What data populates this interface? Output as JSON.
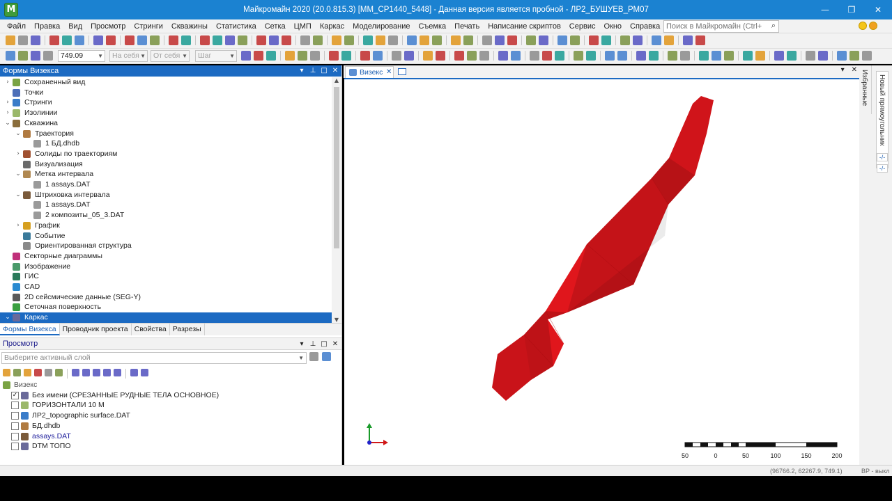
{
  "window": {
    "logo_letter": "M",
    "title": "Майкромайн 2020 (20.0.815.3) [MM_CP1440_5448] - Данная версия является пробной - ЛР2_БУШУЕВ_РМ07",
    "minimize": "—",
    "maximize": "❐",
    "close": "✕"
  },
  "menu": {
    "items": [
      "Файл",
      "Правка",
      "Вид",
      "Просмотр",
      "Стринги",
      "Скважины",
      "Статистика",
      "Сетка",
      "ЦМП",
      "Каркас",
      "Моделирование",
      "Съемка",
      "Печать",
      "Написание скриптов",
      "Сервис",
      "Окно",
      "Справка"
    ],
    "search_placeholder": "Поиск в Майкромайн (Ctrl+Q)"
  },
  "toolbar2": {
    "value": "749.09",
    "from_self": "На себя",
    "to_self": "От себя",
    "step": "Шаг"
  },
  "forms_panel": {
    "title": "Формы Визекса",
    "tree": [
      {
        "label": "Сохраненный вид",
        "level": 0,
        "expander": "›",
        "icon_color": "#7aa343"
      },
      {
        "label": "Точки",
        "level": 0,
        "expander": "",
        "icon_color": "#4d6fb8"
      },
      {
        "label": "Стринги",
        "level": 0,
        "expander": "›",
        "icon_color": "#3a7cc9"
      },
      {
        "label": "Изолинии",
        "level": 0,
        "expander": "›",
        "icon_color": "#9bb86a"
      },
      {
        "label": "Скважина",
        "level": 0,
        "expander": "⌄",
        "icon_color": "#8a6d3b"
      },
      {
        "label": "Траектория",
        "level": 1,
        "expander": "⌄",
        "icon_color": "#b07a40"
      },
      {
        "label": "1 БД.dhdb",
        "level": 2,
        "expander": "",
        "icon_color": "#9a9a9a"
      },
      {
        "label": "Солиды по траекториям",
        "level": 1,
        "expander": "›",
        "icon_color": "#a05030"
      },
      {
        "label": "Визуализация",
        "level": 1,
        "expander": "",
        "icon_color": "#6a6a6a"
      },
      {
        "label": "Метка интервала",
        "level": 1,
        "expander": "⌄",
        "icon_color": "#b08850"
      },
      {
        "label": "1 assays.DAT",
        "level": 2,
        "expander": "",
        "icon_color": "#9a9a9a"
      },
      {
        "label": "Штриховка интервала",
        "level": 1,
        "expander": "⌄",
        "icon_color": "#7a5a3a"
      },
      {
        "label": "1 assays.DAT",
        "level": 2,
        "expander": "",
        "icon_color": "#9a9a9a"
      },
      {
        "label": "2 композиты_05_3.DAT",
        "level": 2,
        "expander": "",
        "icon_color": "#9a9a9a"
      },
      {
        "label": "График",
        "level": 1,
        "expander": "›",
        "icon_color": "#d6a020"
      },
      {
        "label": "Событие",
        "level": 1,
        "expander": "",
        "icon_color": "#3a7a9a"
      },
      {
        "label": "Ориентированная структура",
        "level": 1,
        "expander": "",
        "icon_color": "#8a8a8a"
      },
      {
        "label": "Секторные диаграммы",
        "level": 0,
        "expander": "",
        "icon_color": "#c0307a"
      },
      {
        "label": "Изображение",
        "level": 0,
        "expander": "",
        "icon_color": "#4a9a6a"
      },
      {
        "label": "ГИС",
        "level": 0,
        "expander": "",
        "icon_color": "#2a7a5a"
      },
      {
        "label": "CAD",
        "level": 0,
        "expander": "",
        "icon_color": "#2a8ad0"
      },
      {
        "label": "2D сейсмические данные (SEG-Y)",
        "level": 0,
        "expander": "",
        "icon_color": "#5a5a5a"
      },
      {
        "label": "Сеточная поверхность",
        "level": 0,
        "expander": "",
        "icon_color": "#3aa040"
      },
      {
        "label": "Каркас",
        "level": 0,
        "expander": "⌄",
        "icon_color": "#6a6a9a",
        "selected": true
      }
    ],
    "tabs": [
      "Формы Визекса",
      "Проводник проекта",
      "Свойства",
      "Разрезы"
    ]
  },
  "preview_panel": {
    "title": "Просмотр",
    "layer_placeholder": "Выберите активный слой",
    "root_label": "Визекс",
    "layers": [
      {
        "label": "Без имени (СРЕЗАННЫЕ РУДНЫЕ ТЕЛА ОСНОВНОЕ)",
        "checked": true,
        "color": "#222222",
        "icon_color": "#6a6a9a"
      },
      {
        "label": "ГОРИЗОНТАЛИ 10 М",
        "checked": false,
        "color": "#222222",
        "icon_color": "#9bb86a"
      },
      {
        "label": "ЛР2_topographic surface.DAT",
        "checked": false,
        "color": "#222222",
        "icon_color": "#3a7cc9"
      },
      {
        "label": "БД.dhdb",
        "checked": false,
        "color": "#222222",
        "icon_color": "#b07a40"
      },
      {
        "label": "assays.DAT",
        "checked": false,
        "color": "#1a1a9a",
        "icon_color": "#7a5a3a"
      },
      {
        "label": "DTM ТОПО",
        "checked": false,
        "color": "#222222",
        "icon_color": "#6a6a9a"
      }
    ]
  },
  "viewport": {
    "tab_label": "Визекс",
    "tab_close": "✕",
    "scale_labels": [
      "50",
      "0",
      "50",
      "100",
      "150",
      "200"
    ],
    "orebody_color": "#e0161c"
  },
  "right_strip": {
    "favorites": "Избранные",
    "new_rect": "Новый прямоугольник",
    "mini1": "-/-",
    "mini2": "-/-"
  },
  "statusbar": {
    "coords": "(96766.2, 62267.9, 749.1)",
    "mode": "ВР - выкл"
  }
}
